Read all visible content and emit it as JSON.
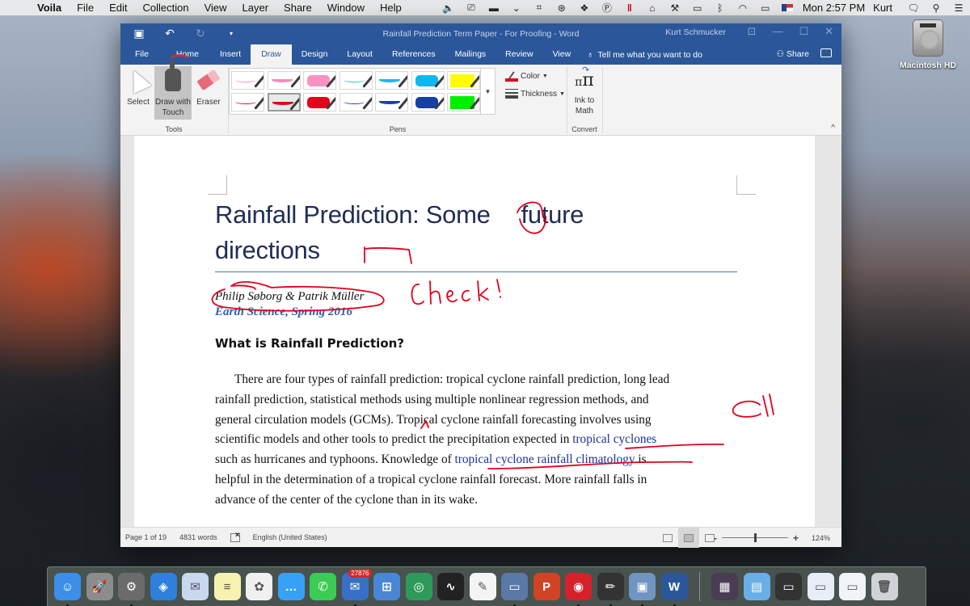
{
  "menubar": {
    "apple_icon": "apple-logo-icon",
    "app_name": "Voila",
    "items": [
      "File",
      "Edit",
      "Collection",
      "View",
      "Layer",
      "Share",
      "Window",
      "Help"
    ],
    "status_icons": [
      "volume-icon",
      "display-icon",
      "battery-case-icon",
      "chevron-down-icon",
      "screenshot-crop-icon",
      "creative-cloud-icon",
      "dropbox-icon",
      "parking-icon",
      "parallels-icon",
      "home-icon",
      "toolbox-icon",
      "airplay-icon",
      "bluetooth-icon",
      "wifi-icon",
      "battery-charging-icon",
      "us-flag-icon"
    ],
    "clock": "Mon 2:57 PM",
    "user": "Kurt",
    "extra_icons": [
      "notification-icon",
      "spotlight-search-icon",
      "notification-center-icon"
    ]
  },
  "desktop": {
    "hd_label": "Macintosh HD"
  },
  "word": {
    "title": "Rainfall Prediction Term Paper - For Proofing  -  Word",
    "account": "Kurt Schmucker",
    "tabs": [
      "File",
      "Home",
      "Insert",
      "Draw",
      "Design",
      "Layout",
      "References",
      "Mailings",
      "Review",
      "View"
    ],
    "active_tab": "Draw",
    "tell_me": "Tell me what you want to do",
    "share": "Share",
    "ribbon": {
      "tools": {
        "label": "Tools",
        "select": "Select",
        "draw_with_touch_1": "Draw with",
        "draw_with_touch_2": "Touch",
        "eraser": "Eraser"
      },
      "pens": {
        "label": "Pens",
        "row1": [
          {
            "type": "pen-thin",
            "color": "#f28cbf"
          },
          {
            "type": "pen-medium",
            "color": "#f28cbf"
          },
          {
            "type": "pen-thick",
            "color": "#f594c4"
          },
          {
            "type": "pen-thin",
            "color": "#1fb7ea"
          },
          {
            "type": "pen-medium",
            "color": "#1fb7ea"
          },
          {
            "type": "pen-thick",
            "color": "#11b6f0"
          },
          {
            "type": "highlighter",
            "color": "#ffff00"
          }
        ],
        "row2": [
          {
            "type": "pen-thin",
            "color": "#e3001b"
          },
          {
            "type": "pen-medium",
            "color": "#e3001b",
            "selected": true
          },
          {
            "type": "pen-thick",
            "color": "#e3001b"
          },
          {
            "type": "pen-thin",
            "color": "#1740a6"
          },
          {
            "type": "pen-medium",
            "color": "#1740a6"
          },
          {
            "type": "pen-thick",
            "color": "#1740a6"
          },
          {
            "type": "highlighter",
            "color": "#00ee00"
          }
        ],
        "color_label": "Color",
        "thickness_label": "Thickness"
      },
      "convert": {
        "label": "Convert",
        "ink_to_math_1": "Ink to",
        "ink_to_math_2": "Math"
      }
    },
    "document": {
      "title_line1": "Rainfall Prediction: Some",
      "title_line1b": "future",
      "title_line2": "directions",
      "authors": "Philip Søborg & Patrik Müller",
      "course": "Earth Science, Spring 2016",
      "heading": "What is Rainfall Prediction?",
      "lines": [
        "There are four types of rainfall prediction: tropical cyclone rainfall prediction, long lead",
        "rainfall prediction, statistical methods using multiple nonlinear regression methods, and",
        "general circulation models (GCMs). Tropical cyclone rainfall forecasting involves using"
      ],
      "line4_pre": "scientific models and other tools to predict the precipitation expected in ",
      "line4_link": "tropical cyclones",
      "line5_pre": "such as hurricanes and typhoons. Knowledge of ",
      "line5_link": "tropical cyclone rainfall climatology",
      "line5_post": " is",
      "line6": "helpful in the determination of a tropical cyclone rainfall forecast. More rainfall falls in",
      "line7": "advance of the center of the cyclone than in its wake.",
      "ink_annotations": {
        "check_note": "Check!",
        "ink_color": "#e3001b"
      }
    },
    "statusbar": {
      "page": "Page 1 of 19",
      "words": "4831 words",
      "language": "English (United States)",
      "zoom_minus": "-",
      "zoom_plus": "+",
      "zoom_level": "124%",
      "zoom_fraction": 0.5
    }
  },
  "dock": {
    "apps": [
      {
        "name": "finder",
        "glyph": "☺",
        "bg": "#3b8fe8",
        "running": true
      },
      {
        "name": "launchpad",
        "glyph": "🚀",
        "bg": "#8c8c8c"
      },
      {
        "name": "system-preferences",
        "glyph": "⚙",
        "bg": "#6b6b6b",
        "running": true
      },
      {
        "name": "safari",
        "glyph": "◈",
        "bg": "#2f7fdc"
      },
      {
        "name": "mail-stamp",
        "glyph": "✉",
        "bg": "#c9d8ee"
      },
      {
        "name": "notes",
        "glyph": "≡",
        "bg": "#f8f2b0"
      },
      {
        "name": "photos",
        "glyph": "✿",
        "bg": "#f0f0f0"
      },
      {
        "name": "messages",
        "glyph": "…",
        "bg": "#37a2f5"
      },
      {
        "name": "facetime",
        "glyph": "✆",
        "bg": "#3ccc55"
      },
      {
        "name": "outlook-mail",
        "glyph": "✉",
        "bg": "#3870c8",
        "badge": "27876",
        "running": true
      },
      {
        "name": "parallels-windows",
        "glyph": "⊞",
        "bg": "#4a86d6"
      },
      {
        "name": "vpn-globe",
        "glyph": "◎",
        "bg": "#2e9a5a"
      },
      {
        "name": "activity-monitor",
        "glyph": "∿",
        "bg": "#222"
      },
      {
        "name": "textedit",
        "glyph": "✎",
        "bg": "#f4f4f4"
      },
      {
        "name": "parallels-window",
        "glyph": "▭",
        "bg": "#5a78a8",
        "running": true
      },
      {
        "name": "powerpoint",
        "glyph": "P",
        "bg": "#d04423"
      },
      {
        "name": "red-dog-app",
        "glyph": "◉",
        "bg": "#d6202a",
        "running": true
      },
      {
        "name": "camera-pencil-app",
        "glyph": "✏",
        "bg": "#333",
        "running": true
      },
      {
        "name": "preview",
        "glyph": "▣",
        "bg": "#6f95c3",
        "running": true
      },
      {
        "name": "word",
        "glyph": "W",
        "bg": "#2b579a",
        "running": true
      }
    ],
    "stacks": [
      {
        "name": "photo-stack",
        "glyph": "▦",
        "bg": "#4a3c52"
      },
      {
        "name": "folder-stack",
        "glyph": "▤",
        "bg": "#6aaee8"
      },
      {
        "name": "safari-window-1",
        "glyph": "▭",
        "bg": "#333"
      },
      {
        "name": "safari-window-2",
        "glyph": "▭",
        "bg": "#e8eef8"
      },
      {
        "name": "outlook-window",
        "glyph": "▭",
        "bg": "#f0f3f8"
      },
      {
        "name": "trash",
        "glyph": "🗑",
        "bg": "#cfd3d6"
      }
    ]
  }
}
